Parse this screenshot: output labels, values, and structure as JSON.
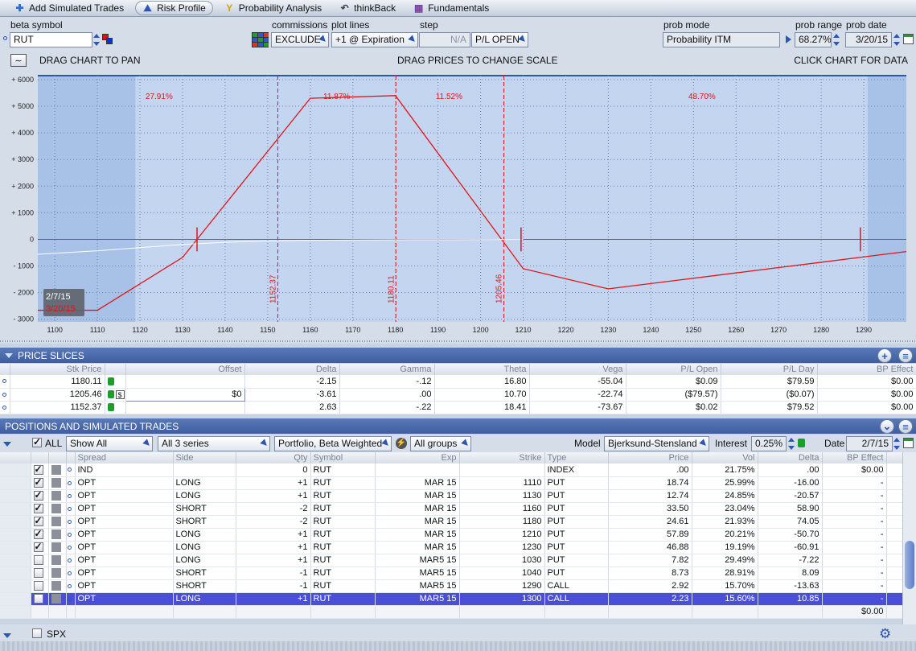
{
  "tabs": [
    {
      "label": "Add Simulated Trades",
      "icon": "plus-icon",
      "active": false
    },
    {
      "label": "Risk Profile",
      "icon": "risk-profile-icon",
      "active": true
    },
    {
      "label": "Probability Analysis",
      "icon": "probability-icon",
      "active": false
    },
    {
      "label": "thinkBack",
      "icon": "thinkback-icon",
      "active": false
    },
    {
      "label": "Fundamentals",
      "icon": "fundamentals-icon",
      "active": false
    }
  ],
  "controls": {
    "beta_symbol_label": "beta symbol",
    "beta_symbol_value": "RUT",
    "commissions_label": "commissions",
    "commissions_value": "EXCLUDE",
    "plot_lines_label": "plot lines",
    "plot_lines_value": "+1 @ Expiration",
    "step_label": "step",
    "step_value": "N/A",
    "pl_mode_value": "P/L OPEN",
    "prob_mode_label": "prob mode",
    "prob_mode_value": "Probability ITM",
    "prob_range_label": "prob range",
    "prob_range_value": "68.27%",
    "prob_date_label": "prob date",
    "prob_date_value": "3/20/15"
  },
  "chart_header": {
    "left": "DRAG CHART TO PAN",
    "center": "DRAG PRICES TO CHANGE SCALE",
    "right": "CLICK CHART FOR DATA"
  },
  "chart_data": {
    "type": "line",
    "xlim": [
      1096,
      1300
    ],
    "ylim": [
      -3100,
      6150
    ],
    "x_ticks": [
      1100,
      1110,
      1120,
      1130,
      1140,
      1150,
      1160,
      1170,
      1180,
      1190,
      1200,
      1210,
      1220,
      1230,
      1240,
      1250,
      1260,
      1270,
      1280,
      1290
    ],
    "y_ticks": [
      -3000,
      -2000,
      -1000,
      0,
      1000,
      2000,
      3000,
      4000,
      5000,
      6000
    ],
    "y_tick_labels": [
      "- 3000",
      "- 2000",
      "- 1000",
      "0",
      "+ 1000",
      "+ 2000",
      "+ 3000",
      "+ 4000",
      "+ 5000",
      "+ 6000"
    ],
    "shaded_range": [
      1118.9,
      1290.9
    ],
    "series": [
      {
        "color": "#e0151b",
        "x": [
          1096,
          1110,
          1130,
          1160,
          1180,
          1210,
          1230,
          1250,
          1270,
          1290,
          1300
        ],
        "y": [
          -2664,
          -2664,
          -678,
          5300,
          5400,
          -1100,
          -1860,
          -1460,
          -1060,
          -660,
          -460
        ]
      },
      {
        "color": "#ffffff",
        "x": [
          1096,
          1110,
          1130,
          1140,
          1150,
          1160,
          1170,
          1180,
          1190,
          1200,
          1210
        ],
        "y": [
          -560,
          -430,
          -190,
          -110,
          -60,
          -35,
          -25,
          -15,
          -12,
          -8,
          -5
        ]
      }
    ],
    "price_slices": [
      {
        "x": 1152.37,
        "label": "1152.37"
      },
      {
        "x": 1180.11,
        "label": "1180.11"
      },
      {
        "x": 1205.46,
        "label": "1205.46"
      }
    ],
    "probability_labels": [
      {
        "x": 1124.5,
        "text": "27.91%"
      },
      {
        "x": 1166.2,
        "text": "11.87%"
      },
      {
        "x": 1192.6,
        "text": "11.52%"
      },
      {
        "x": 1252,
        "text": "48.70%"
      }
    ],
    "markers": [
      1133.4,
      1209.5,
      1289.2
    ],
    "hover_label": {
      "date": "2/7/15",
      "date2": "3/20/15"
    }
  },
  "price_slices_section": {
    "title": "PRICE SLICES",
    "columns": [
      "Stk Price",
      "Offset",
      "Delta",
      "Gamma",
      "Theta",
      "Vega",
      "P/L Open",
      "P/L Day",
      "BP Effect"
    ],
    "rows": [
      {
        "price": "1180.11",
        "offset": "",
        "delta": "-2.15",
        "gamma": "-.12",
        "theta": "16.80",
        "vega": "-55.04",
        "pl_open": "$0.09",
        "pl_day": "$79.59",
        "bp": "$0.00"
      },
      {
        "price": "1205.46",
        "offset": "$0",
        "delta": "-3.61",
        "gamma": ".00",
        "theta": "10.70",
        "vega": "-22.74",
        "pl_open": "($79.57)",
        "pl_day": "($0.07)",
        "bp": "$0.00"
      },
      {
        "price": "1152.37",
        "offset": "",
        "delta": "2.63",
        "gamma": "-.22",
        "theta": "18.41",
        "vega": "-73.67",
        "pl_open": "$0.02",
        "pl_day": "$79.52",
        "bp": "$0.00"
      }
    ]
  },
  "positions_section": {
    "title": "POSITIONS AND SIMULATED TRADES",
    "all_label": "ALL",
    "show_value": "Show All",
    "series_value": "All 3 series",
    "portfolio_value": "Portfolio, Beta Weighted",
    "groups_value": "All groups",
    "model_label": "Model",
    "model_value": "Bjerksund-Stensland",
    "interest_label": "Interest",
    "interest_value": "0.25%",
    "date_label": "Date",
    "date_value": "2/7/15",
    "columns": [
      "Spread",
      "Side",
      "Qty",
      "Symbol",
      "Exp",
      "Strike",
      "Type",
      "Price",
      "Vol",
      "Delta",
      "BP Effect"
    ],
    "rows": [
      {
        "checked": true,
        "spread": "IND",
        "side": "",
        "qty": "0",
        "symbol": "RUT",
        "exp": "",
        "strike": "",
        "type": "INDEX",
        "price": ".00",
        "vol": "21.75%",
        "delta": ".00",
        "bp": "$0.00"
      },
      {
        "checked": true,
        "spread": "OPT",
        "side": "LONG",
        "qty": "+1",
        "symbol": "RUT",
        "exp": "MAR 15",
        "strike": "1110",
        "type": "PUT",
        "price": "18.74",
        "vol": "25.99%",
        "delta": "-16.00",
        "bp": "-"
      },
      {
        "checked": true,
        "spread": "OPT",
        "side": "LONG",
        "qty": "+1",
        "symbol": "RUT",
        "exp": "MAR 15",
        "strike": "1130",
        "type": "PUT",
        "price": "12.74",
        "vol": "24.85%",
        "delta": "-20.57",
        "bp": "-"
      },
      {
        "checked": true,
        "spread": "OPT",
        "side": "SHORT",
        "qty": "-2",
        "symbol": "RUT",
        "exp": "MAR 15",
        "strike": "1160",
        "type": "PUT",
        "price": "33.50",
        "vol": "23.04%",
        "delta": "58.90",
        "bp": "-"
      },
      {
        "checked": true,
        "spread": "OPT",
        "side": "SHORT",
        "qty": "-2",
        "symbol": "RUT",
        "exp": "MAR 15",
        "strike": "1180",
        "type": "PUT",
        "price": "24.61",
        "vol": "21.93%",
        "delta": "74.05",
        "bp": "-"
      },
      {
        "checked": true,
        "spread": "OPT",
        "side": "LONG",
        "qty": "+1",
        "symbol": "RUT",
        "exp": "MAR 15",
        "strike": "1210",
        "type": "PUT",
        "price": "57.89",
        "vol": "20.21%",
        "delta": "-50.70",
        "bp": "-"
      },
      {
        "checked": true,
        "spread": "OPT",
        "side": "LONG",
        "qty": "+1",
        "symbol": "RUT",
        "exp": "MAR 15",
        "strike": "1230",
        "type": "PUT",
        "price": "46.88",
        "vol": "19.19%",
        "delta": "-60.91",
        "bp": "-"
      },
      {
        "checked": false,
        "spread": "OPT",
        "side": "LONG",
        "qty": "+1",
        "symbol": "RUT",
        "exp": "MAR5 15",
        "strike": "1030",
        "type": "PUT",
        "price": "7.82",
        "vol": "29.49%",
        "delta": "-7.22",
        "bp": "-"
      },
      {
        "checked": false,
        "spread": "OPT",
        "side": "SHORT",
        "qty": "-1",
        "symbol": "RUT",
        "exp": "MAR5 15",
        "strike": "1040",
        "type": "PUT",
        "price": "8.73",
        "vol": "28.91%",
        "delta": "8.09",
        "bp": "-"
      },
      {
        "checked": false,
        "spread": "OPT",
        "side": "SHORT",
        "qty": "-1",
        "symbol": "RUT",
        "exp": "MAR5 15",
        "strike": "1290",
        "type": "CALL",
        "price": "2.92",
        "vol": "15.70%",
        "delta": "-13.63",
        "bp": "-"
      },
      {
        "checked": false,
        "spread": "OPT",
        "side": "LONG",
        "qty": "+1",
        "symbol": "RUT",
        "exp": "MAR5 15",
        "strike": "1300",
        "type": "CALL",
        "price": "2.23",
        "vol": "15.60%",
        "delta": "10.85",
        "bp": "-",
        "selected": true
      }
    ],
    "total_bp": "$0.00",
    "group_label": "SPX"
  }
}
